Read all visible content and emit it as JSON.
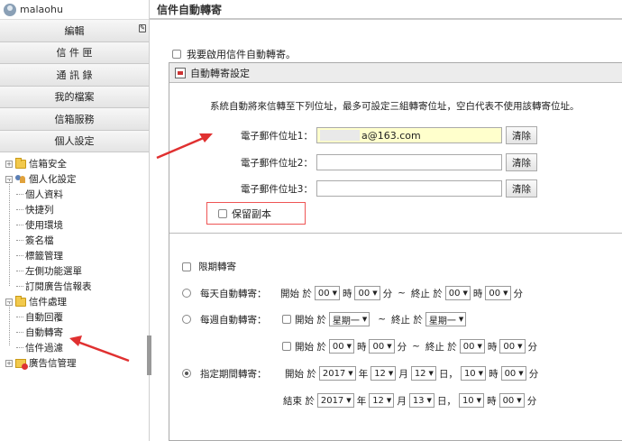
{
  "sidebar": {
    "username": "malaohu",
    "edit_label": "編輯",
    "buttons": [
      "信 件 匣",
      "通 訊 錄",
      "我的檔案",
      "信箱服務",
      "個人設定"
    ],
    "tree": {
      "security": "信箱安全",
      "personal": "個人化設定",
      "personal_children": [
        "個人資料",
        "快捷列",
        "使用環境",
        "簽名檔",
        "標籤管理",
        "左側功能選單",
        "訂閱廣告信報表"
      ],
      "mail": "信件處理",
      "mail_children": [
        "自動回覆",
        "自動轉寄",
        "信件過濾"
      ],
      "ads": "廣告信管理"
    }
  },
  "main": {
    "title": "信件自動轉寄",
    "enable_label": "我要啟用信件自動轉寄。",
    "panel_title": "自動轉寄設定",
    "description": "系統自動將來信轉至下列位址，最多可設定三組轉寄位址，空白代表不使用該轉寄位址。",
    "addresses": [
      {
        "label": "電子郵件位址1：",
        "value": "a@163.com"
      },
      {
        "label": "電子郵件位址2：",
        "value": ""
      },
      {
        "label": "電子郵件位址3：",
        "value": ""
      }
    ],
    "clear_label": "清除",
    "keep_copy_label": "保留副本",
    "limit_label": "限期轉寄",
    "daily": {
      "label": "每天自動轉寄：",
      "start": "開始 於",
      "start_hour": "00",
      "hour_unit": "時",
      "start_min": "00",
      "min_unit": "分",
      "tilde": "~",
      "end": "終止 於",
      "end_hour": "00",
      "end_min": "00"
    },
    "weekly": {
      "label": "每週自動轉寄：",
      "start": "開始 於",
      "start_day": "星期一",
      "tilde": "~",
      "end": "終止 於",
      "end_day": "星期一",
      "start2": "開始 於",
      "start_hour": "00",
      "hour_unit": "時",
      "start_min": "00",
      "min_unit": "分",
      "end2": "終止 於",
      "end_hour": "00",
      "end_min": "00"
    },
    "period": {
      "label": "指定期間轉寄：",
      "start": "開始 於",
      "start_year": "2017",
      "year_unit": "年",
      "start_month": "12",
      "month_unit": "月",
      "start_day": "12",
      "day_unit": "日，",
      "start_hour": "10",
      "hour_unit": "時",
      "start_min": "00",
      "min_unit": "分",
      "end": "結束 於",
      "end_year": "2017",
      "end_month": "12",
      "end_day": "13",
      "end_hour": "10",
      "end_min": "00"
    }
  },
  "colors": {
    "highlight_input": "#ffffcc",
    "annotation_red": "#e03030"
  }
}
